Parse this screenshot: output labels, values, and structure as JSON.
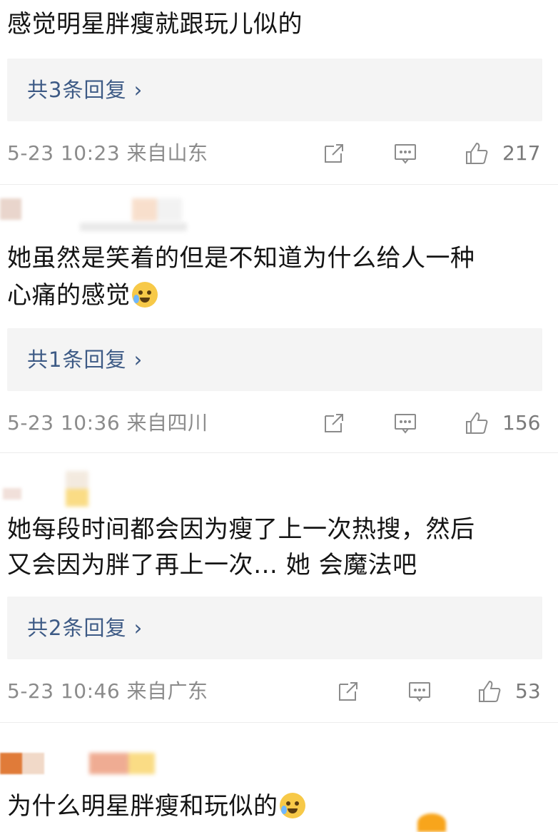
{
  "comments": [
    {
      "text": "感觉明星胖瘦就跟玩儿似的",
      "reply_label": "共3条回复 ›",
      "time": "5-23 10:23 来自山东",
      "likes": "217"
    },
    {
      "text_line1": "她虽然是笑着的但是不知道为什么给人一种",
      "text_line2": "心痛的感觉",
      "reply_label": "共1条回复 ›",
      "time": "5-23 10:36 来自四川",
      "likes": "156"
    },
    {
      "text_line1": "她每段时间都会因为瘦了上一次热搜，然后",
      "text_line2": "又会因为胖了再上一次… 她 会魔法吧",
      "reply_label": "共2条回复 ›",
      "time": "5-23 10:46 来自广东",
      "likes": "53"
    },
    {
      "text": "为什么明星胖瘦和玩似的"
    }
  ],
  "icons": {
    "share": "share-icon",
    "comment": "comment-icon",
    "like": "thumbs-up-icon",
    "emoji_cry": "crying-face-emoji",
    "emoji_laugh": "laughing-tears-emoji"
  },
  "colors": {
    "reply_link": "#3d5a85",
    "meta_gray": "#8b8b8b",
    "reply_bg": "#f4f4f4"
  }
}
